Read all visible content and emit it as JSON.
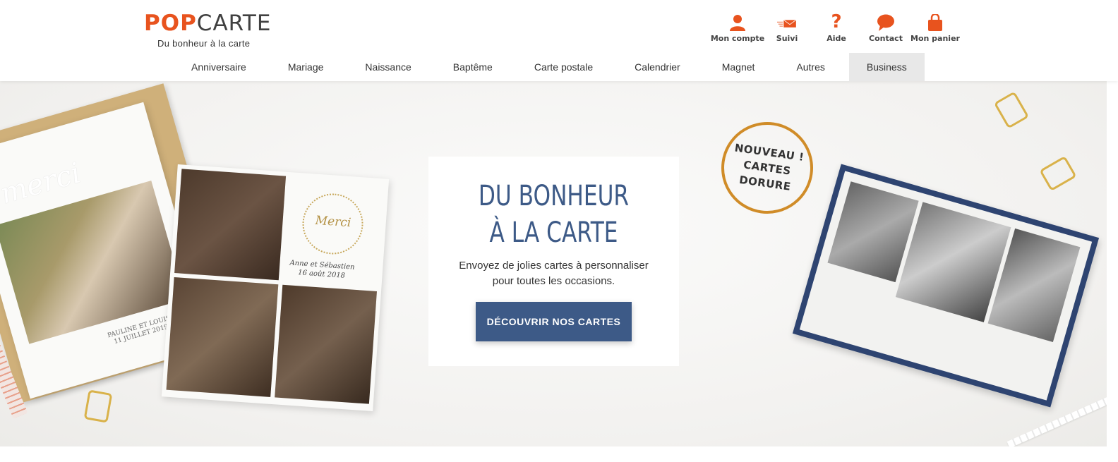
{
  "logo": {
    "part1": "POP",
    "part2": "CARTE",
    "tagline": "Du bonheur à la carte"
  },
  "account_nav": [
    {
      "label": "Mon compte",
      "icon": "user-icon"
    },
    {
      "label": "Suivi",
      "icon": "envelope-icon"
    },
    {
      "label": "Aide",
      "icon": "question-icon"
    },
    {
      "label": "Contact",
      "icon": "chat-bubble-icon"
    },
    {
      "label": "Mon panier",
      "icon": "shopping-bag-icon"
    }
  ],
  "main_nav": [
    {
      "label": "Anniversaire"
    },
    {
      "label": "Mariage"
    },
    {
      "label": "Naissance"
    },
    {
      "label": "Baptême"
    },
    {
      "label": "Carte postale"
    },
    {
      "label": "Calendrier"
    },
    {
      "label": "Magnet"
    },
    {
      "label": "Autres"
    },
    {
      "label": "Business",
      "active": true
    }
  ],
  "hero": {
    "title_line1": "DU BONHEUR",
    "title_line2": "À LA CARTE",
    "subtitle_line1": "Envoyez de jolies cartes à personnaliser",
    "subtitle_line2": "pour toutes les occasions.",
    "cta": "DÉCOUVRIR NOS CARTES",
    "badge_line1": "NOUVEAU !",
    "badge_line2": "CARTES",
    "badge_line3": "DORURE",
    "card1_script": "merci",
    "card1_caption_line1": "PAULINE ET LOUIS",
    "card1_caption_line2": "11 JUILLET 2019",
    "card2_script": "Merci",
    "card2_names_line1": "Anne et Sébastien",
    "card2_names_line2": "16 août 2018"
  },
  "colors": {
    "brand_orange": "#e8531e",
    "brand_blue": "#3d5a87",
    "nav_active_bg": "#e8e8e8",
    "badge_gold": "#d08c28"
  }
}
